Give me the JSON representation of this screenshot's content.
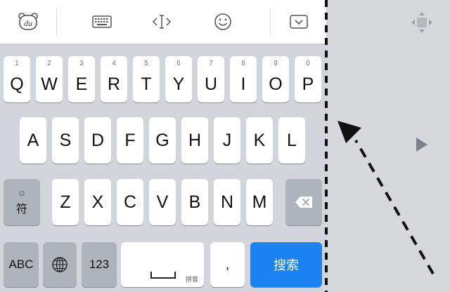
{
  "toolbar": {
    "logo_text": "du",
    "icons": [
      "du-logo-icon",
      "keyboard-icon",
      "cursor-icon",
      "emoji-icon",
      "collapse-icon"
    ]
  },
  "keys": {
    "row1": [
      {
        "letter": "Q",
        "hint": "1"
      },
      {
        "letter": "W",
        "hint": "2"
      },
      {
        "letter": "E",
        "hint": "3"
      },
      {
        "letter": "R",
        "hint": "4"
      },
      {
        "letter": "T",
        "hint": "5"
      },
      {
        "letter": "Y",
        "hint": "6"
      },
      {
        "letter": "U",
        "hint": "7"
      },
      {
        "letter": "I",
        "hint": "8"
      },
      {
        "letter": "O",
        "hint": "9"
      },
      {
        "letter": "P",
        "hint": "0"
      }
    ],
    "row2": [
      "A",
      "S",
      "D",
      "F",
      "G",
      "H",
      "J",
      "K",
      "L"
    ],
    "row3": [
      "Z",
      "X",
      "C",
      "V",
      "B",
      "N",
      "M"
    ],
    "symbol": {
      "icon": "☺",
      "label": "符"
    },
    "abc": "ABC",
    "num": "123",
    "space_hint": "拼音",
    "comma": ",",
    "search": "搜索"
  },
  "colors": {
    "search_blue": "#1b82f1",
    "function_key": "#aeb3bc"
  }
}
